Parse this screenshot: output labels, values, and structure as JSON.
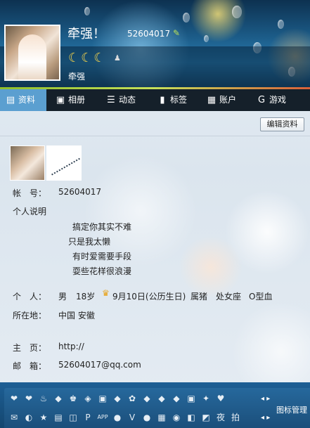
{
  "profile": {
    "nickname": "牵强！",
    "qq_number": "52604017",
    "signature": "牵强"
  },
  "icons": {
    "moons": "☾☾☾",
    "level": "♟",
    "edit": "✎",
    "crown": "♛"
  },
  "tabs": [
    {
      "label": "资料",
      "icon": "id-card-icon",
      "glyph": "▤"
    },
    {
      "label": "相册",
      "icon": "photo-album-icon",
      "glyph": "▣"
    },
    {
      "label": "动态",
      "icon": "feed-icon",
      "glyph": "☰"
    },
    {
      "label": "标签",
      "icon": "bookmark-icon",
      "glyph": "▮"
    },
    {
      "label": "账户",
      "icon": "wallet-icon",
      "glyph": "▦"
    },
    {
      "label": "游戏",
      "icon": "game-icon",
      "glyph": "G"
    }
  ],
  "toolbar": {
    "edit_label": "编辑资料"
  },
  "info": {
    "account_label": "帐　号：",
    "account_value": "52604017",
    "desc_label": "个人说明",
    "desc_lines": [
      "搞定你其实不难",
      "只是我太懒",
      "有时爱需要手段",
      "耍些花样很浪漫"
    ],
    "person_label": "个　人：",
    "gender": "男",
    "age": "18岁",
    "birthday": "9月10日(公历生日)",
    "zodiac": "属猪",
    "constellation": "处女座",
    "blood": "O型血",
    "location_label": "所在地：",
    "location_value": "中国 安徽",
    "homepage_label": "主　页：",
    "homepage_value": "http://",
    "email_label": "邮　箱：",
    "email_value": "52604017@qq.com"
  },
  "bottom": {
    "manage_label": "图标管理",
    "row1": [
      "❤",
      "❤",
      "♨",
      "◆",
      "♚",
      "◈",
      "▣",
      "◆",
      "✿",
      "◆",
      "◆",
      "◆",
      "▣",
      "✦",
      "♥"
    ],
    "row2": [
      "✉",
      "◐",
      "★",
      "▤",
      "◫",
      "P",
      "APP",
      "●",
      "V",
      "●",
      "▦",
      "◉",
      "◧",
      "◩",
      "夜",
      "拍"
    ]
  },
  "colors": {
    "tab_bar": "#15202a",
    "tab_active": "#5b9fd0",
    "bottom_bar": "#1d5f95"
  }
}
